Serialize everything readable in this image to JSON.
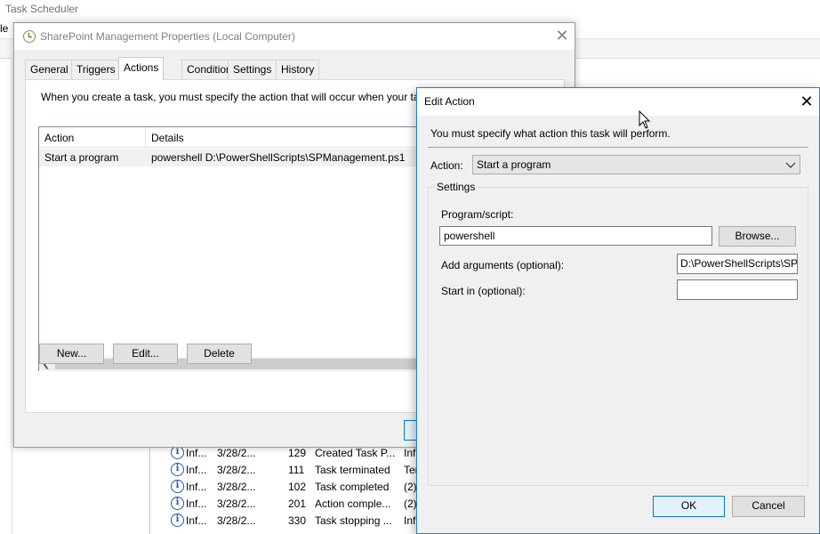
{
  "background_window": {
    "title": "Task Scheduler",
    "menu_file_fragment": "le",
    "history_rows": [
      {
        "level": "Inf...",
        "date": "3/28/2...",
        "event_id": "129",
        "category": "Created Task P...",
        "op": "Inf"
      },
      {
        "level": "Inf...",
        "date": "3/28/2...",
        "event_id": "111",
        "category": "Task terminated",
        "op": "Ter"
      },
      {
        "level": "Inf...",
        "date": "3/28/2...",
        "event_id": "102",
        "category": "Task completed",
        "op": "(2)"
      },
      {
        "level": "Inf...",
        "date": "3/28/2...",
        "event_id": "201",
        "category": "Action comple...",
        "op": "(2)"
      },
      {
        "level": "Inf...",
        "date": "3/28/2...",
        "event_id": "330",
        "category": "Task stopping ...",
        "op": "Inf"
      }
    ]
  },
  "properties_dialog": {
    "title": "SharePoint Management Properties (Local Computer)",
    "tabs": [
      {
        "label": "General",
        "active": false
      },
      {
        "label": "Triggers",
        "active": false
      },
      {
        "label": "Actions",
        "active": true
      },
      {
        "label": "Conditions",
        "active": false
      },
      {
        "label": "Settings",
        "active": false
      },
      {
        "label": "History",
        "active": false
      }
    ],
    "description": "When you create a task, you must specify the action that will occur when your ta",
    "list": {
      "columns": [
        "Action",
        "Details"
      ],
      "rows": [
        {
          "action": "Start a program",
          "details": "powershell D:\\PowerShellScripts\\SPManagement.ps1"
        }
      ]
    },
    "buttons": {
      "new": "New...",
      "edit": "Edit...",
      "delete": "Delete"
    }
  },
  "edit_action_dialog": {
    "title": "Edit Action",
    "instruction": "You must specify what action this task will perform.",
    "action_label": "Action:",
    "action_value": "Start a program",
    "settings_legend": "Settings",
    "program_label": "Program/script:",
    "program_value": "powershell",
    "browse_label": "Browse...",
    "arguments_label": "Add arguments (optional):",
    "arguments_value": "D:\\PowerShellScripts\\SPI",
    "start_in_label": "Start in (optional):",
    "start_in_value": "",
    "ok_label": "OK",
    "cancel_label": "Cancel"
  },
  "colors": {
    "focus_border": "#0078d7",
    "dialog_bg": "#f0f0f0",
    "info_icon": "#1d5aa8"
  }
}
